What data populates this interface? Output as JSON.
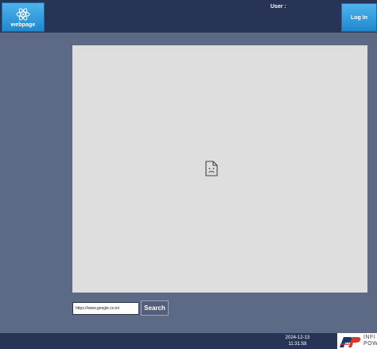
{
  "header": {
    "app_tile_label": "webpage",
    "user_label": "User :",
    "login_label": "Log In"
  },
  "browser": {
    "url_value": "https://www.google.co.in/",
    "search_label": "Search"
  },
  "footer": {
    "date": "2024-12-13",
    "time": "11:31:58",
    "logo_text_line1": "INFI",
    "logo_text_line2": "POW"
  },
  "icons": {
    "app_tile": "atom-icon",
    "frame": "broken-page-icon",
    "logo": "rp-logo"
  },
  "colors": {
    "page_background": "#5d6a86",
    "bar_background": "#273456",
    "accent": "#2b95dc",
    "frame_background": "#dedede"
  }
}
